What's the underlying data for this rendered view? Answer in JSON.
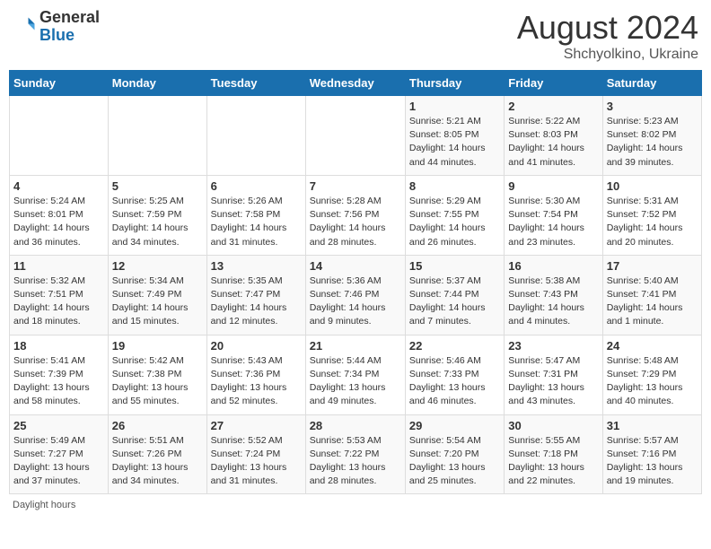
{
  "header": {
    "logo": {
      "general": "General",
      "blue": "Blue"
    },
    "title": "August 2024",
    "subtitle": "Shchyolkino, Ukraine"
  },
  "weekdays": [
    "Sunday",
    "Monday",
    "Tuesday",
    "Wednesday",
    "Thursday",
    "Friday",
    "Saturday"
  ],
  "weeks": [
    [
      {
        "day": "",
        "info": ""
      },
      {
        "day": "",
        "info": ""
      },
      {
        "day": "",
        "info": ""
      },
      {
        "day": "",
        "info": ""
      },
      {
        "day": "1",
        "info": "Sunrise: 5:21 AM\nSunset: 8:05 PM\nDaylight: 14 hours\nand 44 minutes."
      },
      {
        "day": "2",
        "info": "Sunrise: 5:22 AM\nSunset: 8:03 PM\nDaylight: 14 hours\nand 41 minutes."
      },
      {
        "day": "3",
        "info": "Sunrise: 5:23 AM\nSunset: 8:02 PM\nDaylight: 14 hours\nand 39 minutes."
      }
    ],
    [
      {
        "day": "4",
        "info": "Sunrise: 5:24 AM\nSunset: 8:01 PM\nDaylight: 14 hours\nand 36 minutes."
      },
      {
        "day": "5",
        "info": "Sunrise: 5:25 AM\nSunset: 7:59 PM\nDaylight: 14 hours\nand 34 minutes."
      },
      {
        "day": "6",
        "info": "Sunrise: 5:26 AM\nSunset: 7:58 PM\nDaylight: 14 hours\nand 31 minutes."
      },
      {
        "day": "7",
        "info": "Sunrise: 5:28 AM\nSunset: 7:56 PM\nDaylight: 14 hours\nand 28 minutes."
      },
      {
        "day": "8",
        "info": "Sunrise: 5:29 AM\nSunset: 7:55 PM\nDaylight: 14 hours\nand 26 minutes."
      },
      {
        "day": "9",
        "info": "Sunrise: 5:30 AM\nSunset: 7:54 PM\nDaylight: 14 hours\nand 23 minutes."
      },
      {
        "day": "10",
        "info": "Sunrise: 5:31 AM\nSunset: 7:52 PM\nDaylight: 14 hours\nand 20 minutes."
      }
    ],
    [
      {
        "day": "11",
        "info": "Sunrise: 5:32 AM\nSunset: 7:51 PM\nDaylight: 14 hours\nand 18 minutes."
      },
      {
        "day": "12",
        "info": "Sunrise: 5:34 AM\nSunset: 7:49 PM\nDaylight: 14 hours\nand 15 minutes."
      },
      {
        "day": "13",
        "info": "Sunrise: 5:35 AM\nSunset: 7:47 PM\nDaylight: 14 hours\nand 12 minutes."
      },
      {
        "day": "14",
        "info": "Sunrise: 5:36 AM\nSunset: 7:46 PM\nDaylight: 14 hours\nand 9 minutes."
      },
      {
        "day": "15",
        "info": "Sunrise: 5:37 AM\nSunset: 7:44 PM\nDaylight: 14 hours\nand 7 minutes."
      },
      {
        "day": "16",
        "info": "Sunrise: 5:38 AM\nSunset: 7:43 PM\nDaylight: 14 hours\nand 4 minutes."
      },
      {
        "day": "17",
        "info": "Sunrise: 5:40 AM\nSunset: 7:41 PM\nDaylight: 14 hours\nand 1 minute."
      }
    ],
    [
      {
        "day": "18",
        "info": "Sunrise: 5:41 AM\nSunset: 7:39 PM\nDaylight: 13 hours\nand 58 minutes."
      },
      {
        "day": "19",
        "info": "Sunrise: 5:42 AM\nSunset: 7:38 PM\nDaylight: 13 hours\nand 55 minutes."
      },
      {
        "day": "20",
        "info": "Sunrise: 5:43 AM\nSunset: 7:36 PM\nDaylight: 13 hours\nand 52 minutes."
      },
      {
        "day": "21",
        "info": "Sunrise: 5:44 AM\nSunset: 7:34 PM\nDaylight: 13 hours\nand 49 minutes."
      },
      {
        "day": "22",
        "info": "Sunrise: 5:46 AM\nSunset: 7:33 PM\nDaylight: 13 hours\nand 46 minutes."
      },
      {
        "day": "23",
        "info": "Sunrise: 5:47 AM\nSunset: 7:31 PM\nDaylight: 13 hours\nand 43 minutes."
      },
      {
        "day": "24",
        "info": "Sunrise: 5:48 AM\nSunset: 7:29 PM\nDaylight: 13 hours\nand 40 minutes."
      }
    ],
    [
      {
        "day": "25",
        "info": "Sunrise: 5:49 AM\nSunset: 7:27 PM\nDaylight: 13 hours\nand 37 minutes."
      },
      {
        "day": "26",
        "info": "Sunrise: 5:51 AM\nSunset: 7:26 PM\nDaylight: 13 hours\nand 34 minutes."
      },
      {
        "day": "27",
        "info": "Sunrise: 5:52 AM\nSunset: 7:24 PM\nDaylight: 13 hours\nand 31 minutes."
      },
      {
        "day": "28",
        "info": "Sunrise: 5:53 AM\nSunset: 7:22 PM\nDaylight: 13 hours\nand 28 minutes."
      },
      {
        "day": "29",
        "info": "Sunrise: 5:54 AM\nSunset: 7:20 PM\nDaylight: 13 hours\nand 25 minutes."
      },
      {
        "day": "30",
        "info": "Sunrise: 5:55 AM\nSunset: 7:18 PM\nDaylight: 13 hours\nand 22 minutes."
      },
      {
        "day": "31",
        "info": "Sunrise: 5:57 AM\nSunset: 7:16 PM\nDaylight: 13 hours\nand 19 minutes."
      }
    ]
  ],
  "footer": "Daylight hours"
}
